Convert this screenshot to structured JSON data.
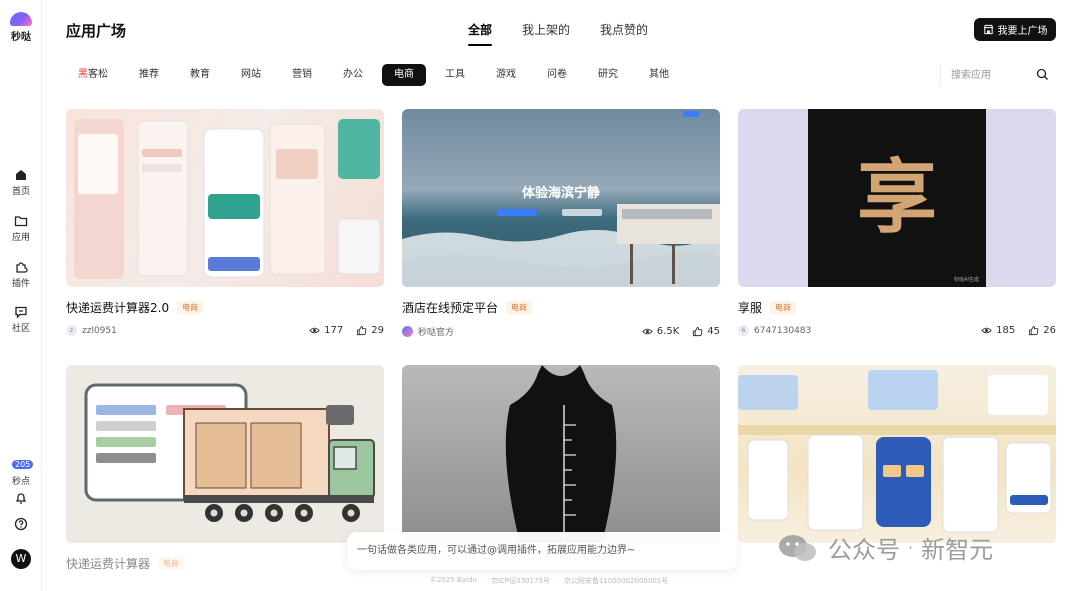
{
  "rail": {
    "logo_text": "秒哒",
    "items": [
      {
        "label": "首页",
        "icon": "home-icon"
      },
      {
        "label": "应用",
        "icon": "folder-icon"
      },
      {
        "label": "插件",
        "icon": "plugin-icon"
      },
      {
        "label": "社区",
        "icon": "chat-icon"
      }
    ],
    "points_count": "205",
    "points_label": "秒点",
    "avatar_letter": "W"
  },
  "header": {
    "title": "应用广场",
    "tabs": [
      "全部",
      "我上架的",
      "我点赞的"
    ],
    "active_tab": "全部",
    "publish_label": "我要上广场"
  },
  "categories": {
    "first_prefix": "黑",
    "first_rest": "客松",
    "items": [
      "推荐",
      "教育",
      "网站",
      "营销",
      "办公",
      "电商",
      "工具",
      "游戏",
      "问卷",
      "研究",
      "其他"
    ],
    "active": "电商"
  },
  "search": {
    "placeholder": "搜索应用"
  },
  "cards": [
    {
      "title": "快递运费计算器2.0",
      "tag": "电商",
      "author": "zzl0951",
      "views": "177",
      "likes": "29",
      "avatar": "z"
    },
    {
      "title": "酒店在线预定平台",
      "tag": "电商",
      "author": "秒哒官方",
      "views": "6.5K",
      "likes": "45",
      "avatar": ""
    },
    {
      "title": "享服",
      "tag": "电商",
      "author": "6747130483",
      "views": "185",
      "likes": "26",
      "avatar": "6",
      "thumb_text": "享",
      "thumb_corner": "秒哒AI生成"
    },
    {
      "title": "快递运费计算器",
      "tag": "电商"
    },
    {},
    {}
  ],
  "hotel_hero": {
    "title": "体验海滨宁静"
  },
  "prompt": {
    "placeholder": "一句话做各类应用，可以通过@调用插件，拓展应用能力边界~"
  },
  "footer": {
    "items": [
      "©2025 Baidu",
      "京ICP证030173号",
      "京公网安备11000002000001号"
    ]
  },
  "watermark": {
    "text": "公众号",
    "sep": "·",
    "brand": "新智元"
  },
  "colors": {
    "accent": "#111111",
    "tag_text": "#e07a2a",
    "tag_bg": "#fff2e6"
  }
}
